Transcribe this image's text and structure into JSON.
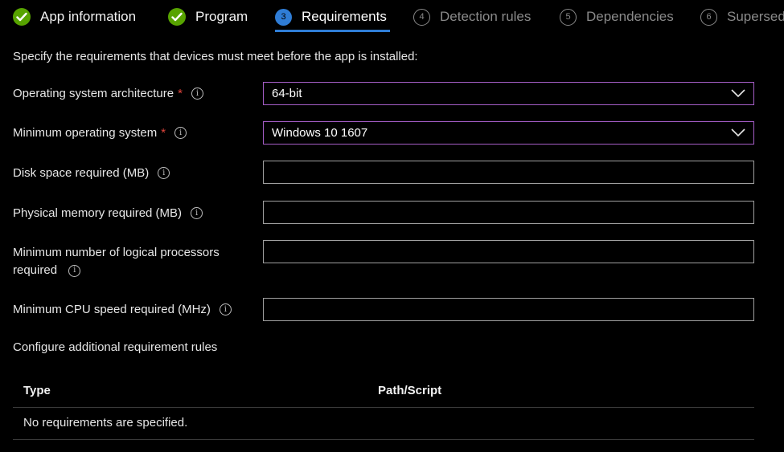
{
  "wizard": {
    "steps": [
      {
        "label": "App information",
        "state": "done",
        "icon": "check-icon"
      },
      {
        "label": "Program",
        "state": "done",
        "icon": "check-icon"
      },
      {
        "label": "Requirements",
        "state": "current",
        "number": "3"
      },
      {
        "label": "Detection rules",
        "state": "pending",
        "number": "4"
      },
      {
        "label": "Dependencies",
        "state": "pending",
        "number": "5"
      },
      {
        "label": "Supersed",
        "state": "pending",
        "number": "6"
      }
    ]
  },
  "form": {
    "intro": "Specify the requirements that devices must meet before the app is installed:",
    "required_marker": "*",
    "info_glyph": "i",
    "os_architecture": {
      "label": "Operating system architecture",
      "value": "64-bit"
    },
    "min_os": {
      "label": "Minimum operating system",
      "value": "Windows 10 1607"
    },
    "disk_space": {
      "label": "Disk space required (MB)",
      "value": ""
    },
    "physical_memory": {
      "label": "Physical memory required (MB)",
      "value": ""
    },
    "logical_processors": {
      "label_line1": "Minimum number of logical processors",
      "label_line2": "required",
      "value": ""
    },
    "cpu_speed": {
      "label": "Minimum CPU speed required (MHz)",
      "value": ""
    },
    "additional_rules": "Configure additional requirement rules"
  },
  "table": {
    "columns": [
      "Type",
      "Path/Script"
    ],
    "empty_message": "No requirements are specified."
  },
  "colors": {
    "accent_blue": "#2f7dd6",
    "success_green": "#57a300",
    "focus_border": "#a65ec8",
    "required_red": "#e2453c"
  }
}
